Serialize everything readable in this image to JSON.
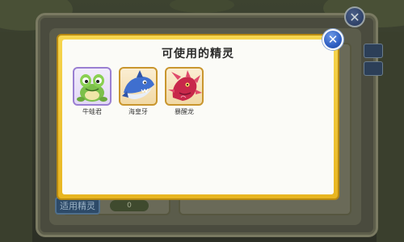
{
  "dialog": {
    "title": "可使用的精灵",
    "close_symbol": "✕"
  },
  "sprites": [
    {
      "name": "牛蛙君",
      "icon": "frog-creature-icon",
      "frame": "purple"
    },
    {
      "name": "海皇牙",
      "icon": "blue-shark-creature-icon",
      "frame": "gold"
    },
    {
      "name": "暴醒龙",
      "icon": "red-dragon-creature-icon",
      "frame": "gold"
    }
  ],
  "background_window": {
    "close_symbol": "✕",
    "button_label": "适用精灵",
    "counter_value": "0"
  },
  "colors": {
    "modal_border": "#e8b520",
    "modal_body": "#fbfbf7",
    "close_button": "#2f5fc2",
    "overlay": "#33372a"
  }
}
